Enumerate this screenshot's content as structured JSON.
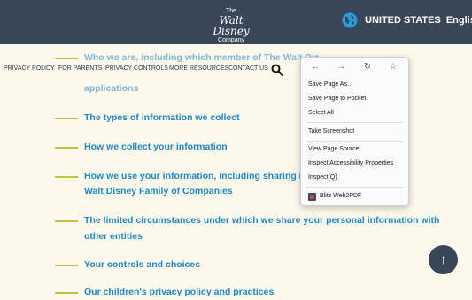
{
  "header": {
    "logo": {
      "the": "The",
      "wordmark": "Walt Disney",
      "company": "Company"
    },
    "region": "UNITED STATES",
    "language": "English",
    "globe_icon": "globe-icon"
  },
  "nav": {
    "items": [
      "PRIVACY POLICY",
      "FOR PARENTS",
      "PRIVACY CONTROLS",
      "MORE RESOURCES",
      "CONTACT US"
    ],
    "search_icon": "search-icon"
  },
  "toc": {
    "faded": [
      "Who we are, including which member of The Walt Dis",
      "applications"
    ],
    "items": [
      "The types of information we collect",
      "How we collect your information",
      "How we use your information, including sharing it wit",
      "Walt Disney Family of Companies",
      "The limited circumstances under which we share your personal information with",
      "other entities",
      "Your controls and choices",
      "Our children's privacy policy and practices"
    ]
  },
  "context_menu": {
    "nav_icons": [
      "back-icon",
      "forward-icon",
      "reload-icon",
      "bookmark-star-icon"
    ],
    "items": [
      "Save Page As…",
      "Save Page to Pocket",
      "Select All",
      "Take Screenshot",
      "View Page Source",
      "Inspect Accessibility Properties",
      "Inspect(Q)",
      "Blitz Web2PDF"
    ]
  },
  "colors": {
    "header_bg": "#384657",
    "link": "#1e87c5",
    "accent_line": "#c5c23a",
    "page_bg": "#fdf8ec"
  }
}
